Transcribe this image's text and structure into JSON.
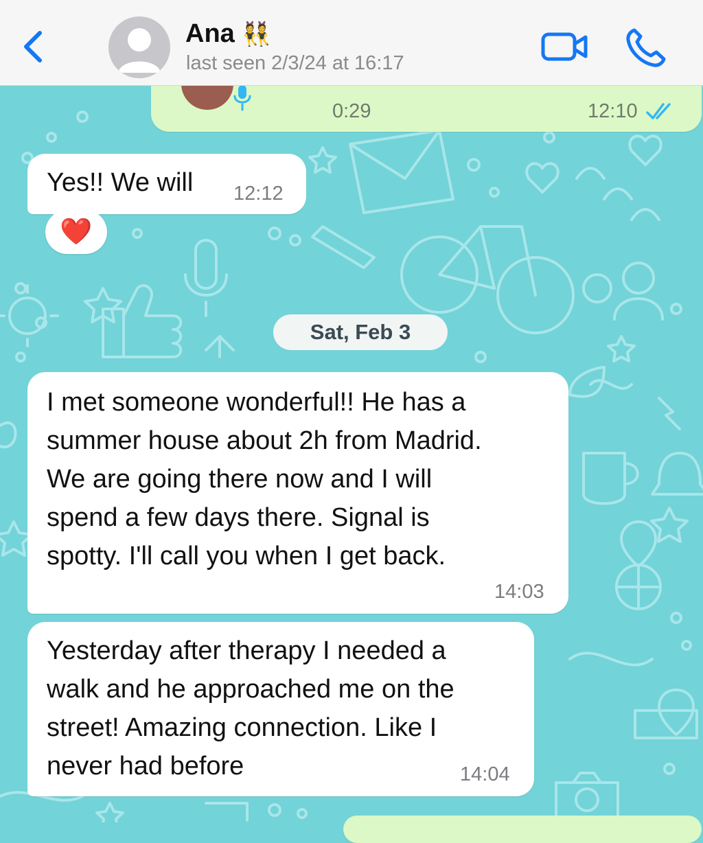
{
  "header": {
    "contact_name": "Ana",
    "name_emoji": "👯",
    "last_seen": "last seen 2/3/24 at 16:17"
  },
  "messages": [
    {
      "direction": "out",
      "type": "voice",
      "duration": "0:29",
      "time": "12:10",
      "read": true
    },
    {
      "direction": "in",
      "text": "Yes!! We will",
      "time": "12:12",
      "reaction": "❤️"
    },
    {
      "direction": "in",
      "lines": [
        "I met someone wonderful!! He has a",
        "summer house about 2h from Madrid.",
        "We are going there now and I will",
        "spend a few days there. Signal is",
        "spotty. I'll call you when I get back."
      ],
      "time": "14:03"
    },
    {
      "direction": "in",
      "lines": [
        "Yesterday after therapy I needed a",
        "walk and he approached me on the",
        "street! Amazing connection. Like I",
        "never had before"
      ],
      "time": "14:04"
    }
  ],
  "date_separator": "Sat, Feb 3",
  "icons": {
    "back": "chevron-left-icon",
    "avatar": "person-icon",
    "video": "video-camera-icon",
    "call": "phone-icon",
    "mic": "microphone-icon",
    "read_receipt": "double-check-icon"
  },
  "colors": {
    "accent": "#1478f4",
    "wallpaper": "#72d3d8",
    "outgoing_bubble": "#dcf8c6",
    "incoming_bubble": "#ffffff",
    "read_receipt": "#34b7f1"
  }
}
